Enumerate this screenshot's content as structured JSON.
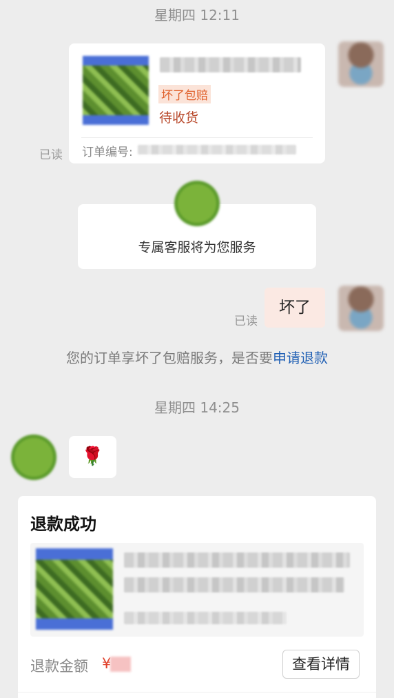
{
  "timestamps": [
    "星期四 12:11",
    "星期四 14:25"
  ],
  "order_card": {
    "tag": "坏了包赔",
    "status": "待收货",
    "order_no_label": "订单编号:"
  },
  "read_label": "已读",
  "service_notice": {
    "text": "专属客服将为您服务"
  },
  "user_message": {
    "text": "坏了"
  },
  "system_notice": {
    "text": "您的订单享坏了包赔服务，是否要",
    "link": "申请退款"
  },
  "service_message": {
    "emoji": "🌹"
  },
  "refund_card": {
    "title": "退款成功",
    "amount_label": "退款金额",
    "currency": "¥",
    "detail_button": "查看详情"
  }
}
